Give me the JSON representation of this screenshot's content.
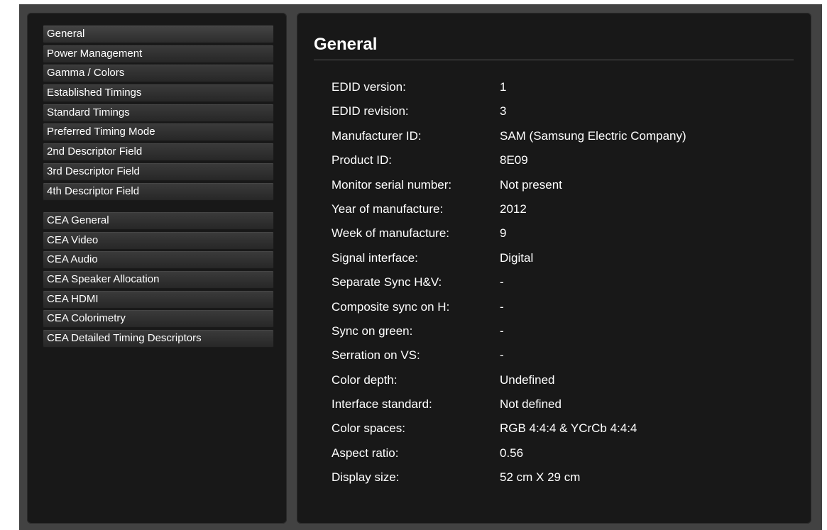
{
  "sidebar": {
    "group1": [
      {
        "label": "General"
      },
      {
        "label": "Power Management"
      },
      {
        "label": "Gamma / Colors"
      },
      {
        "label": "Established Timings"
      },
      {
        "label": "Standard Timings"
      },
      {
        "label": "Preferred Timing Mode"
      },
      {
        "label": "2nd Descriptor Field"
      },
      {
        "label": "3rd Descriptor Field"
      },
      {
        "label": "4th Descriptor Field"
      }
    ],
    "group2": [
      {
        "label": "CEA General"
      },
      {
        "label": "CEA Video"
      },
      {
        "label": "CEA Audio"
      },
      {
        "label": "CEA Speaker Allocation"
      },
      {
        "label": "CEA HDMI"
      },
      {
        "label": "CEA Colorimetry"
      },
      {
        "label": "CEA Detailed Timing Descriptors"
      }
    ],
    "selected": "General"
  },
  "main": {
    "title": "General",
    "properties": [
      {
        "label": "EDID version:",
        "value": "1"
      },
      {
        "label": "EDID revision:",
        "value": "3"
      },
      {
        "label": "Manufacturer ID:",
        "value": "SAM (Samsung Electric Company)"
      },
      {
        "label": "Product ID:",
        "value": "8E09"
      },
      {
        "label": "Monitor serial number:",
        "value": "Not present"
      },
      {
        "label": "Year of manufacture:",
        "value": "2012"
      },
      {
        "label": "Week of manufacture:",
        "value": "9"
      },
      {
        "label": "Signal interface:",
        "value": "Digital"
      },
      {
        "label": "Separate Sync H&V:",
        "value": "-"
      },
      {
        "label": "Composite sync on H:",
        "value": "-"
      },
      {
        "label": "Sync on green:",
        "value": "-"
      },
      {
        "label": "Serration on VS:",
        "value": "-"
      },
      {
        "label": "Color depth:",
        "value": "Undefined"
      },
      {
        "label": "Interface standard:",
        "value": "Not defined"
      },
      {
        "label": "Color spaces:",
        "value": "RGB 4:4:4 & YCrCb 4:4:4"
      },
      {
        "label": "Aspect ratio:",
        "value": "0.56"
      },
      {
        "label": "Display size:",
        "value": "52 cm X 29 cm"
      }
    ]
  },
  "colors": {
    "frame": "#424242",
    "panel": "#181818",
    "text": "#ffffff"
  }
}
